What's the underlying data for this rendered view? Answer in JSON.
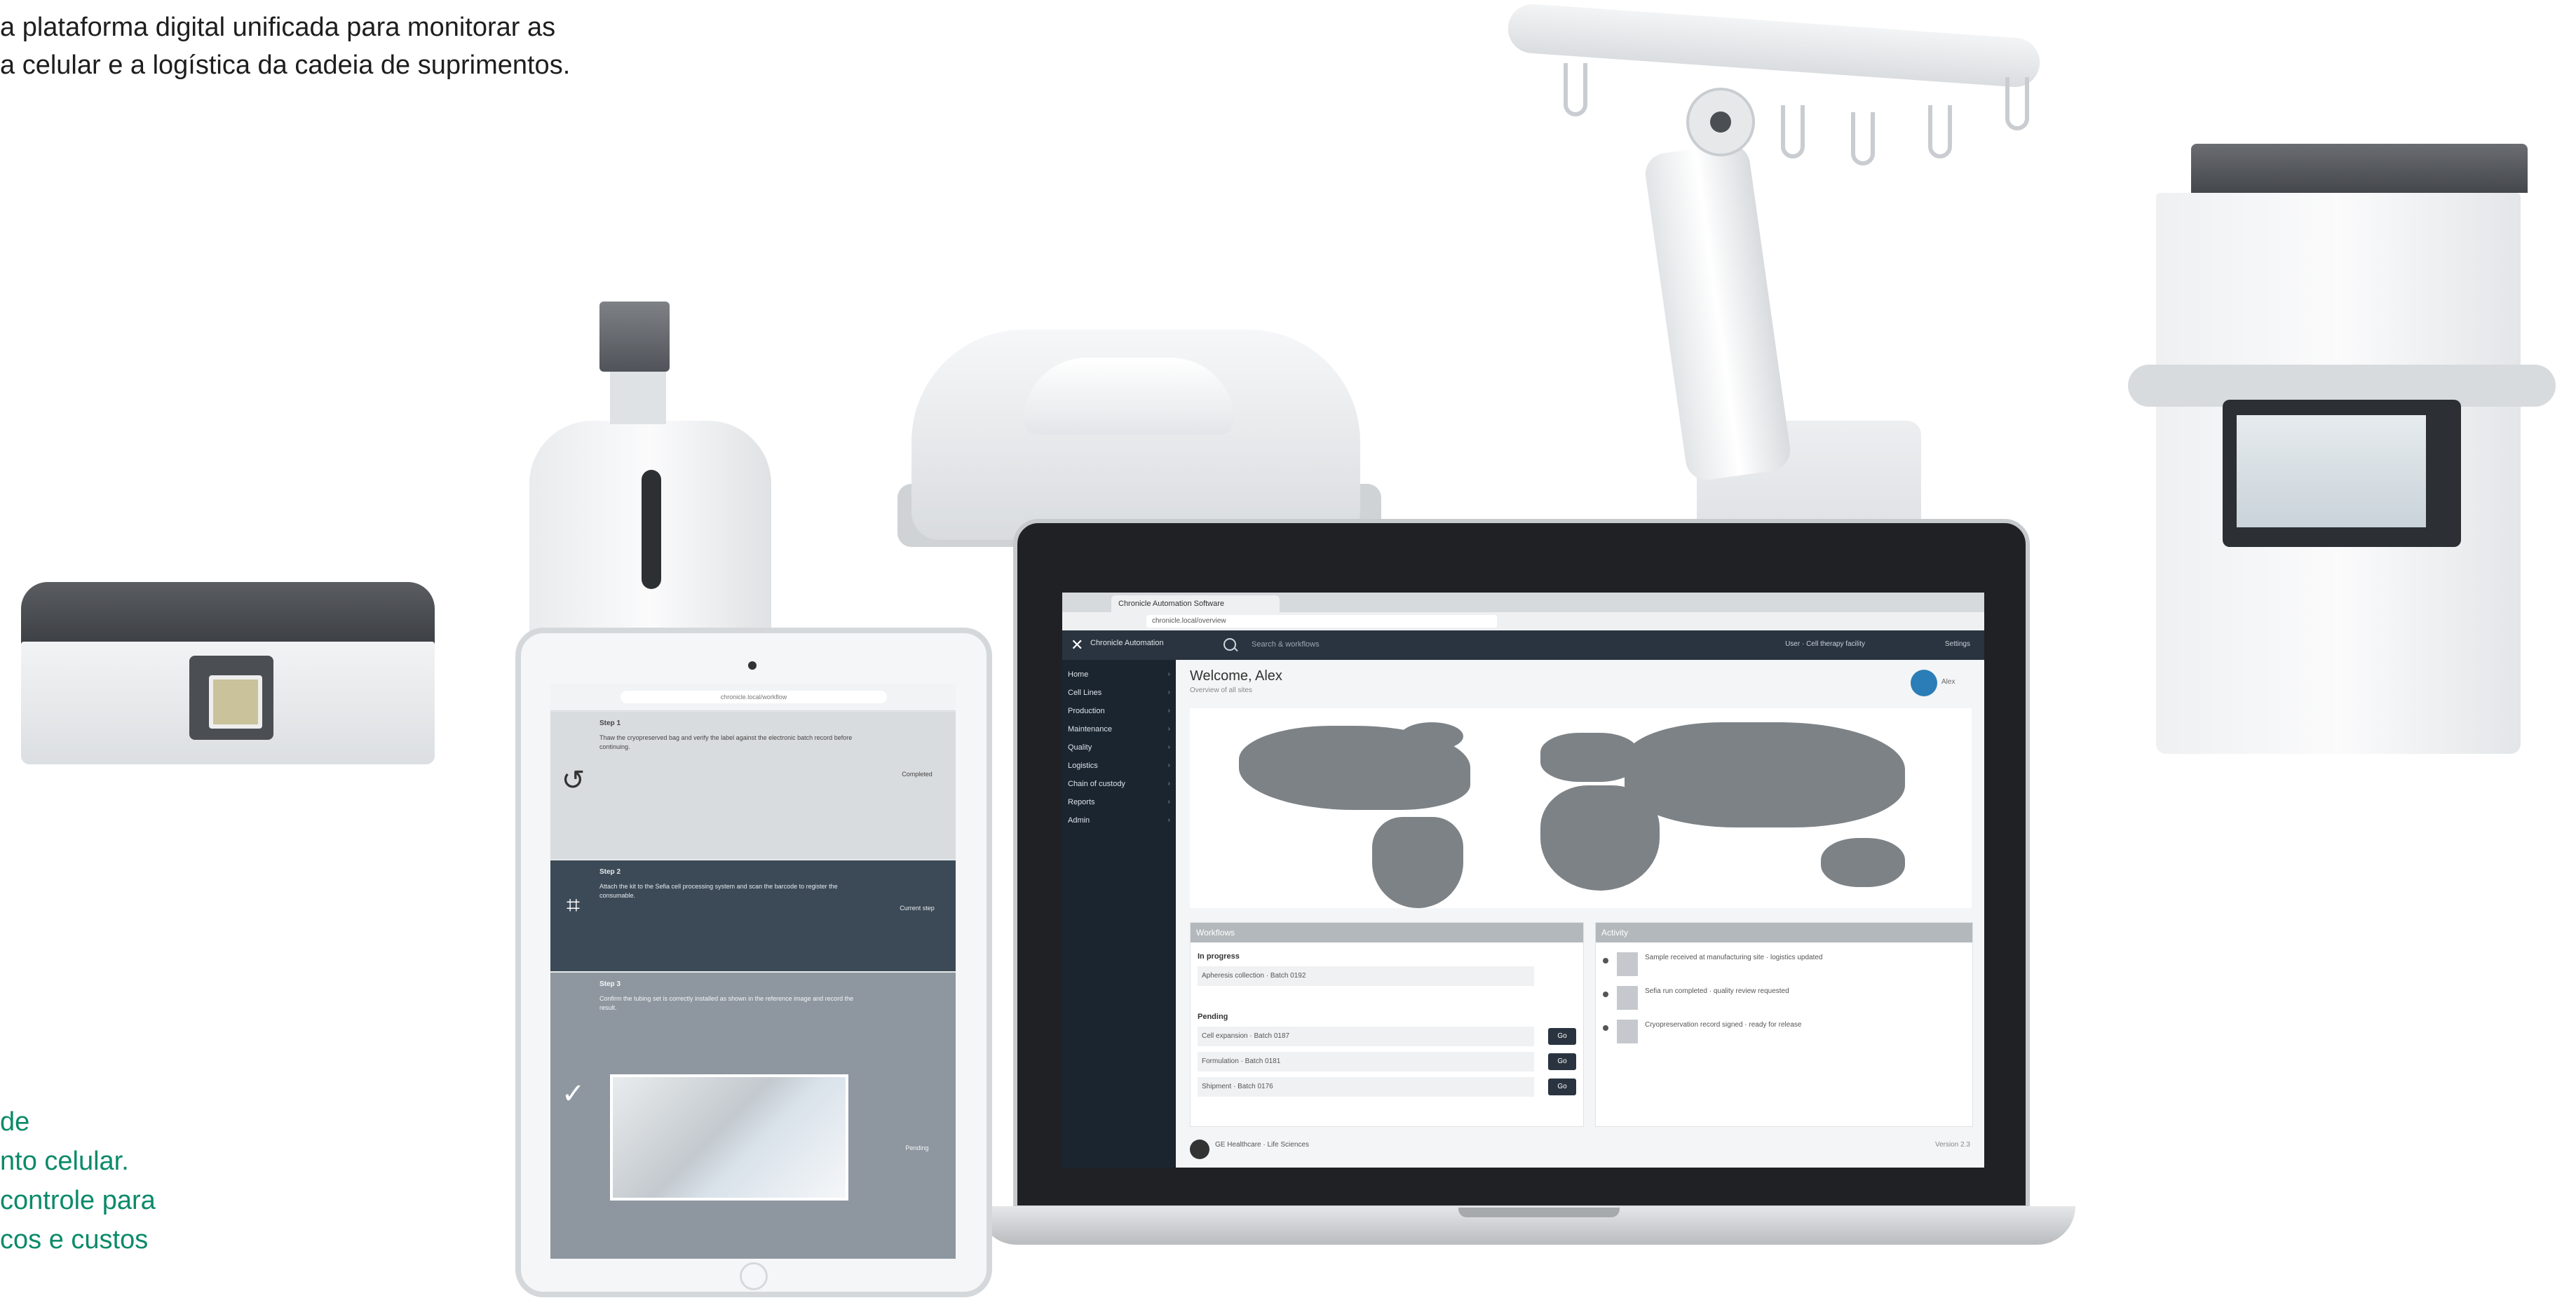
{
  "marketing": {
    "headline_line1": "a plataforma digital unificada para monitorar as",
    "headline_line2": "a celular e a logística da cadeia de suprimentos.",
    "features_line1": "de",
    "features_line2": "nto celular.",
    "features_line3": "controle para",
    "features_line4": "cos e custos"
  },
  "colors": {
    "feature_text": "#0b8a6a",
    "app_topbar": "#2a3440",
    "app_sidebar": "#1b2530",
    "map_land": "#7d8286"
  },
  "laptop_app": {
    "browser_tab": "Chronicle Automation Software",
    "address": "chronicle.local/overview",
    "brand": "Chronicle Automation",
    "search_placeholder": "Search & workflows",
    "top_user": "User · Cell therapy facility",
    "top_tool": "Settings",
    "sidebar_items": [
      {
        "label": "Home",
        "icon": "home-icon"
      },
      {
        "label": "Cell Lines",
        "icon": "cells-icon"
      },
      {
        "label": "Production",
        "icon": "production-icon"
      },
      {
        "label": "Maintenance",
        "icon": "wrench-icon"
      },
      {
        "label": "Quality",
        "icon": "check-icon"
      },
      {
        "label": "Logistics",
        "icon": "truck-icon"
      },
      {
        "label": "Chain of custody",
        "icon": "chain-icon"
      },
      {
        "label": "Reports",
        "icon": "report-icon"
      },
      {
        "label": "Admin",
        "icon": "gear-icon"
      }
    ],
    "page_title": "Welcome, Alex",
    "page_subtitle": "Overview of all sites",
    "avatar_name": "Alex",
    "workflows_panel": {
      "title": "Workflows",
      "in_progress_label": "In progress",
      "in_progress_item": "Apheresis collection · Batch 0192",
      "pending_label": "Pending",
      "pending_items": [
        {
          "text": "Cell expansion · Batch 0187",
          "action": "Go"
        },
        {
          "text": "Formulation · Batch 0181",
          "action": "Go"
        },
        {
          "text": "Shipment · Batch 0176",
          "action": "Go"
        }
      ]
    },
    "activity_panel": {
      "title": "Activity",
      "items": [
        "Sample received at manufacturing site · logistics updated",
        "Sefia run completed · quality review requested",
        "Cryopreservation record signed · ready for release"
      ]
    },
    "footer_left": "GE Healthcare · Life Sciences",
    "footer_right": "Version 2.3"
  },
  "tablet_app": {
    "address": "chronicle.local/workflow",
    "steps": [
      {
        "title": "Step 1",
        "body": "Thaw the cryopreserved bag and verify the label against the electronic batch record before continuing.",
        "status": "Completed",
        "icon": "undo-icon"
      },
      {
        "title": "Step 2",
        "body": "Attach the kit to the Sefia cell processing system and scan the barcode to register the consumable.",
        "status": "Current step",
        "icon": "scan-icon"
      },
      {
        "title": "Step 3",
        "body": "Confirm the tubing set is correctly installed as shown in the reference image and record the result.",
        "status": "Pending",
        "icon": "check-icon"
      }
    ]
  }
}
